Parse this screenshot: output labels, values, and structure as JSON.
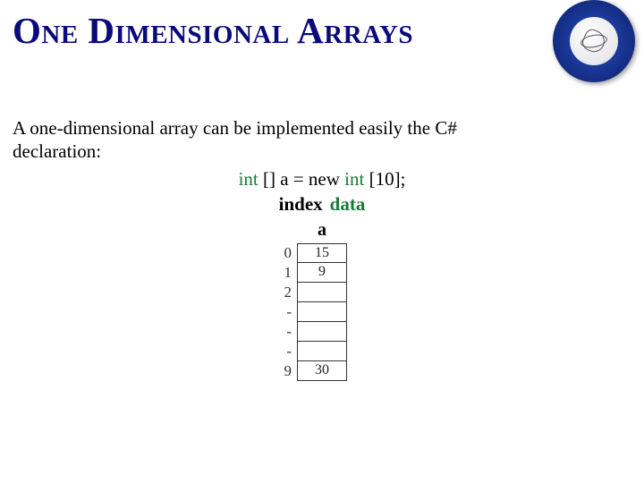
{
  "title": "One Dimensional Arrays",
  "paragraph": "A one-dimensional array can be implemented easily the C# declaration:",
  "code": {
    "kw1": "int",
    "mid": " [] a = new ",
    "kw2": "int",
    "tail": " [10];"
  },
  "labels": {
    "index": "index",
    "data": "data"
  },
  "array_name": "a",
  "array": {
    "rows": [
      {
        "index": "0",
        "value": "15"
      },
      {
        "index": "1",
        "value": "9"
      },
      {
        "index": "2",
        "value": ""
      },
      {
        "index": "-",
        "value": ""
      },
      {
        "index": "-",
        "value": ""
      },
      {
        "index": "-",
        "value": ""
      },
      {
        "index": "9",
        "value": "30"
      }
    ]
  }
}
